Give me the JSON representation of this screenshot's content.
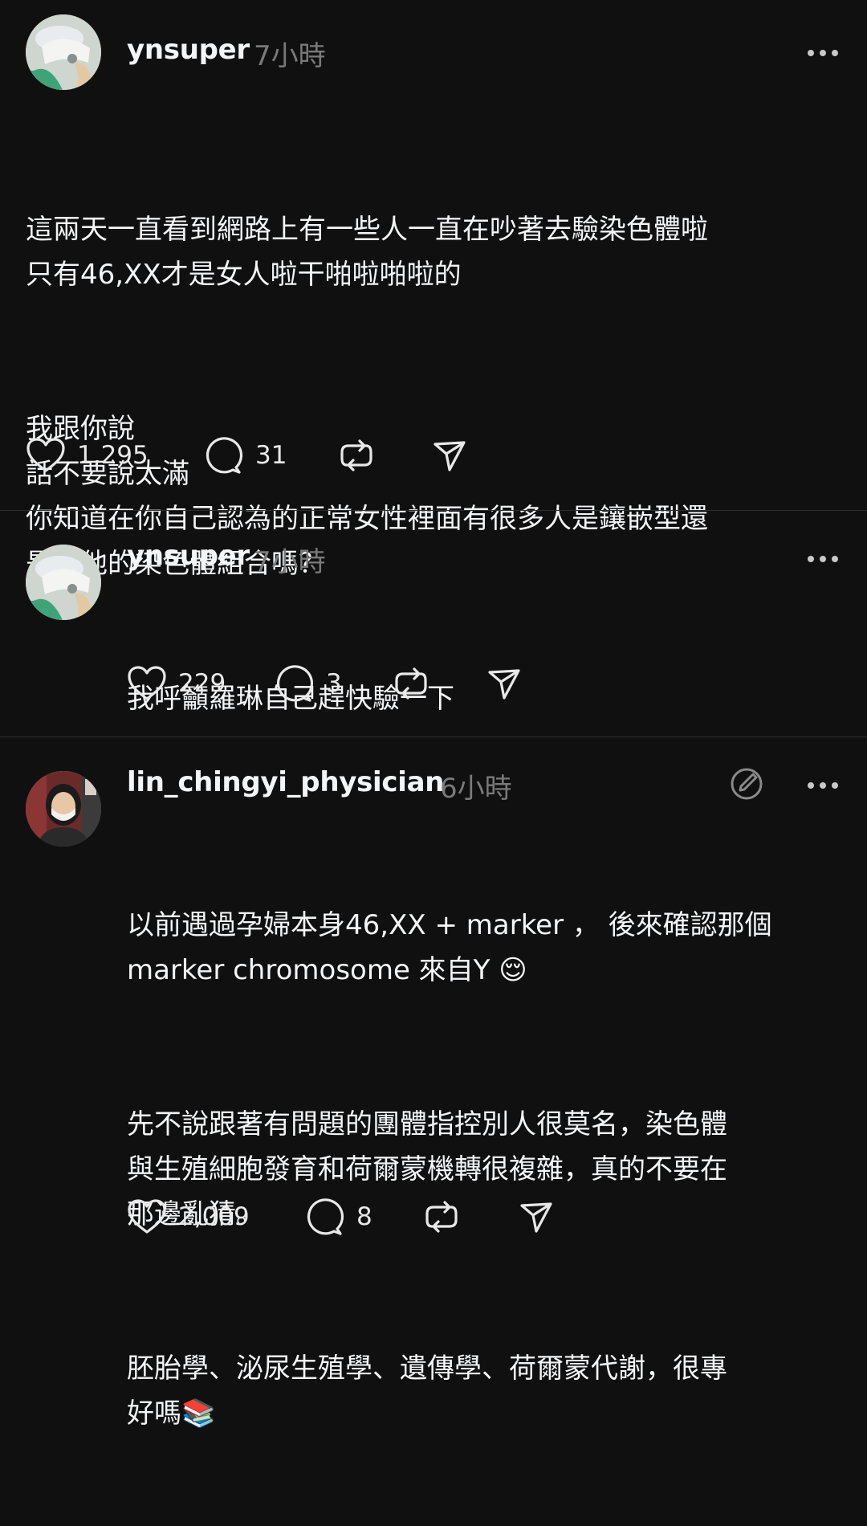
{
  "posts": [
    {
      "username": "ynsuper",
      "time": "7小時",
      "paragraphs": [
        "這兩天一直看到網路上有一些人一直在吵著去驗染色體啦\n只有46,XX才是女人啦干啪啦啪啦的",
        "我跟你說\n話不要說太滿\n你知道在你自己認為的正常女性裡面有很多人是鑲嵌型還\n是其他的染色體組合嗎？"
      ],
      "likes": "1,295",
      "replies": "31"
    },
    {
      "username": "ynsuper",
      "time": "7小時",
      "paragraphs": [
        "我呼籲羅琳自己趕快驗一下"
      ],
      "likes": "229",
      "replies": "3"
    },
    {
      "username": "lin_chingyi_physician",
      "time": "6小時",
      "paragraphs": [
        "以前遇過孕婦本身46,XX + marker ， 後來確認那個\nmarker chromosome 來自Y 😌",
        "先不說跟著有問題的團體指控別人很莫名，染色體\n與生殖細胞發育和荷爾蒙機轉很複雜，真的不要在\n那邊亂猜。",
        "胚胎學、泌尿生殖學、遺傳學、荷爾蒙代謝，很專\n好嗎📚"
      ],
      "likes": "2,009",
      "replies": "8"
    }
  ],
  "icons": {
    "like": "heart-icon",
    "reply": "comment-icon",
    "repost": "repost-icon",
    "share": "send-icon",
    "more": "more-icon",
    "edit": "edit-icon"
  }
}
